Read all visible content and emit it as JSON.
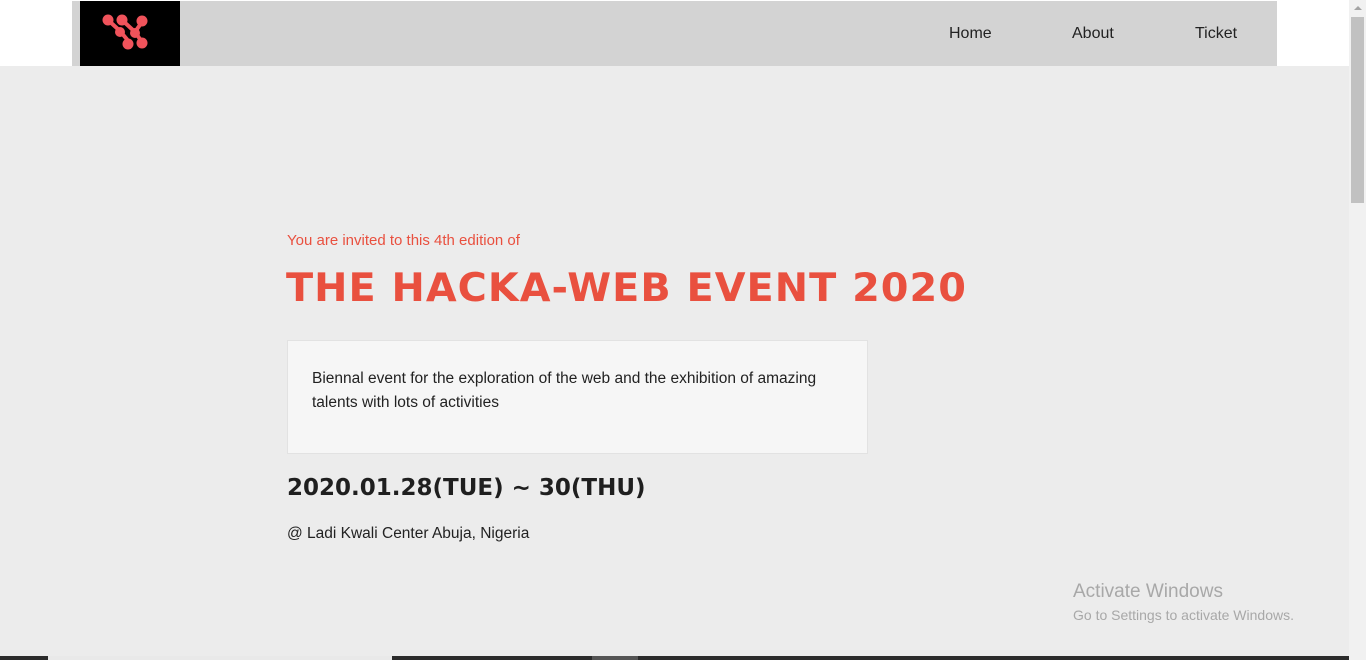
{
  "nav": {
    "links": [
      "Home",
      "About",
      "Ticket"
    ]
  },
  "hero": {
    "invite": "You are invited to this 4th edition of",
    "title": "THE HACKA-WEB EVENT 2020",
    "description": "Biennal event for the exploration of the web and the exhibition of amazing talents with lots of activities",
    "date": "2020.01.28(TUE) ~ 30(THU)",
    "venue": "@ Ladi Kwali Center Abuja, Nigeria"
  },
  "watermark": {
    "title": "Activate Windows",
    "subtitle": "Go to Settings to activate Windows."
  },
  "colors": {
    "accent": "#e9503f",
    "header_bg": "#d3d3d3",
    "hero_bg": "#ececec"
  },
  "icons": {
    "logo": "brand-logo-icon"
  }
}
